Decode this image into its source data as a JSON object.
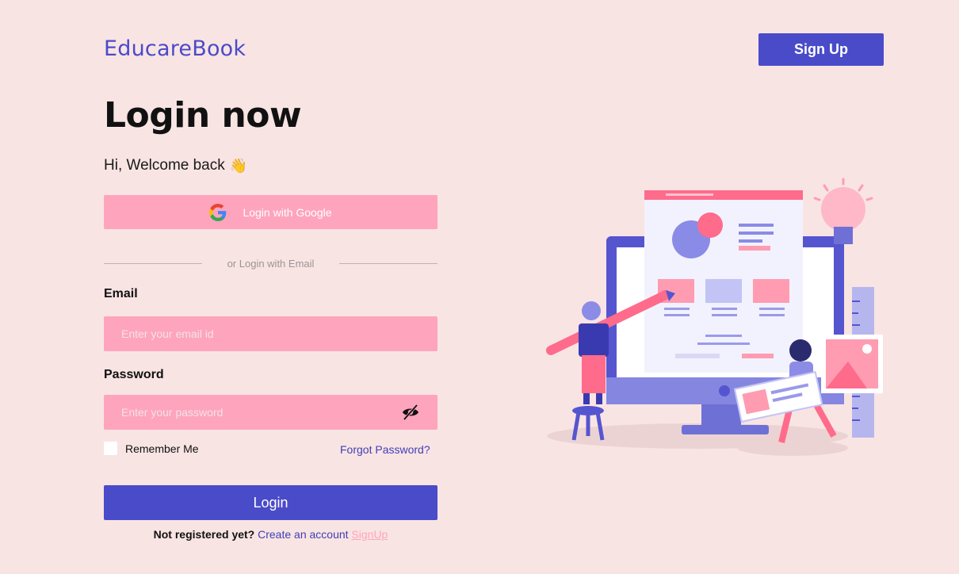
{
  "header": {
    "brand": "EducareBook",
    "signup_label": "Sign Up"
  },
  "login": {
    "title": "Login now",
    "welcome": "Hi, Welcome back",
    "wave_emoji": "👋",
    "google_label": "Login with Google",
    "divider_text": "or Login with Email",
    "email_label": "Email",
    "email_placeholder": "Enter your email id",
    "password_label": "Password",
    "password_placeholder": "Enter your password",
    "remember_label": "Remember Me",
    "forgot_label": "Forgot Password?",
    "login_label": "Login",
    "footer_question": "Not registered yet?",
    "footer_create": "Create an account",
    "footer_signup": "SignUp"
  },
  "colors": {
    "background": "#f9e4e4",
    "accent": "#4a4bc9",
    "pink": "#ffa4bd"
  }
}
